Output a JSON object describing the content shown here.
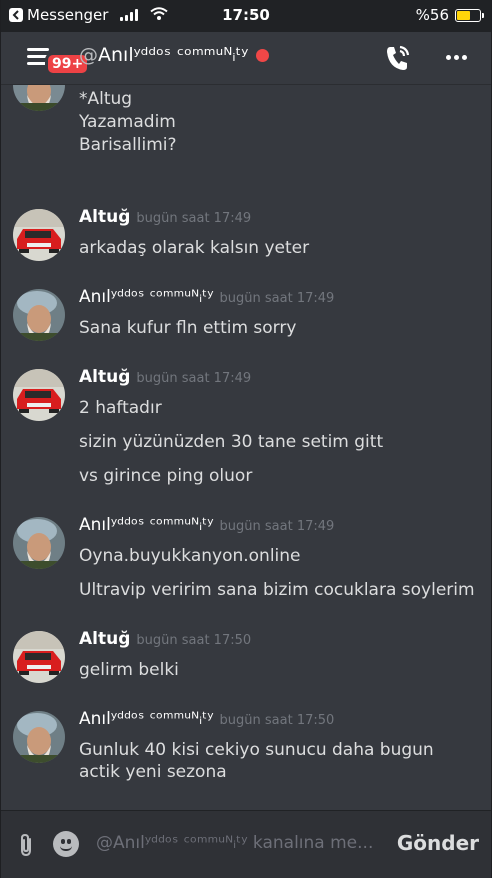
{
  "status_bar": {
    "back_app": "Messenger",
    "time": "17:50",
    "battery": "%56",
    "battery_level": 0.56
  },
  "header": {
    "badge": "99+",
    "at_sign": "@",
    "channel_name": "Anılʸᵈᵈᵒˢ ᶜᵒᵐᵐᵘᴺᵢᵗʸ",
    "status_color": "#f04747",
    "icons": [
      "hamburger-icon",
      "phone-call-icon",
      "more-icon"
    ]
  },
  "messages": {
    "g0": {
      "lines": [
        "*Altug",
        "Yazamadim",
        "Barisallimi?"
      ]
    },
    "g1": {
      "author": "Altuğ",
      "timestamp": "bugün saat 17:49",
      "lines": [
        "arkadaş olarak kalsın yeter"
      ]
    },
    "g2": {
      "author": "Anılʸᵈᵈᵒˢ ᶜᵒᵐᵐᵘᴺᵢᵗʸ",
      "timestamp": "bugün saat 17:49",
      "lines": [
        "Sana kufur fln ettim sorry"
      ]
    },
    "g3": {
      "author": "Altuğ",
      "timestamp": "bugün saat 17:49",
      "lines": [
        "2 haftadır",
        "sizin yüzünüzden 30 tane setim gitt",
        "vs girince ping oluor"
      ]
    },
    "g4": {
      "author": "Anılʸᵈᵈᵒˢ ᶜᵒᵐᵐᵘᴺᵢᵗʸ",
      "timestamp": "bugün saat 17:49",
      "lines": [
        "Oyna.buyukkanyon.online",
        "Ultravip veririm sana bizim cocuklara soylerim"
      ]
    },
    "g5": {
      "author": "Altuğ",
      "timestamp": "bugün saat 17:50",
      "lines": [
        "gelirm belki"
      ]
    },
    "g6": {
      "author": "Anılʸᵈᵈᵒˢ ᶜᵒᵐᵐᵘᴺᵢᵗʸ",
      "timestamp": "bugün saat 17:50",
      "lines": [
        "Gunluk 40 kisi cekiyo sunucu daha bugun actik yeni sezona"
      ]
    }
  },
  "composer": {
    "placeholder": "@Anılʸᵈᵈᵒˢ ᶜᵒᵐᵐᵘᴺᵢᵗʸ kanalına me...",
    "send_label": "Gönder"
  }
}
